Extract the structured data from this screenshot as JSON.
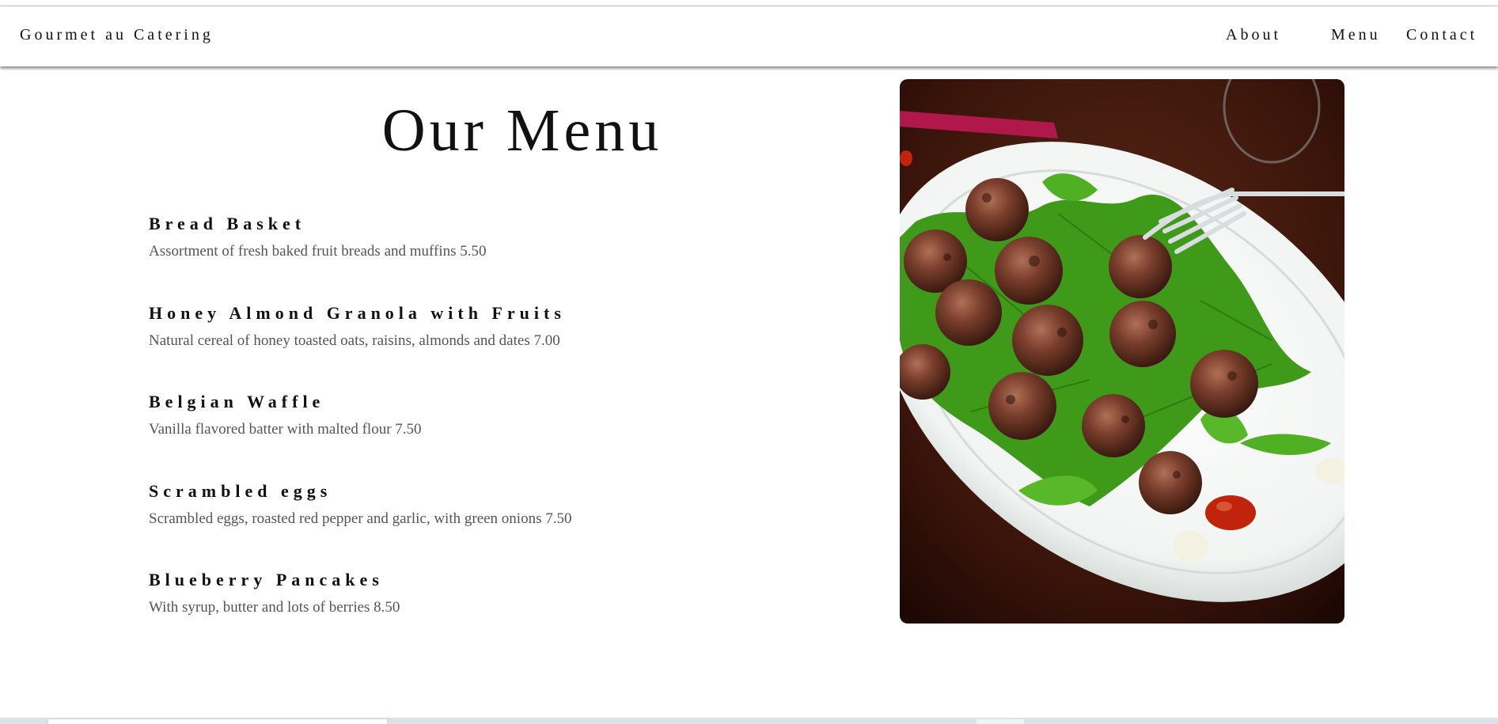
{
  "header": {
    "brand": "Gourmet au Catering",
    "nav": [
      {
        "label": "About"
      },
      {
        "label": "Menu"
      },
      {
        "label": "Contact"
      }
    ]
  },
  "main": {
    "title": "Our Menu",
    "items": [
      {
        "name": "Bread Basket",
        "description": "Assortment of fresh baked fruit breads and muffins 5.50"
      },
      {
        "name": "Honey Almond Granola with Fruits",
        "description": "Natural cereal of honey toasted oats, raisins, almonds and dates 7.00"
      },
      {
        "name": "Belgian Waffle",
        "description": "Vanilla flavored batter with malted flour 7.50"
      },
      {
        "name": "Scrambled eggs",
        "description": "Scrambled eggs, roasted red pepper and garlic, with green onions 7.50"
      },
      {
        "name": "Blueberry Pancakes",
        "description": "With syrup, butter and lots of berries 8.50"
      }
    ],
    "photo": {
      "subject": "meatballs-on-arugula-plate"
    }
  }
}
